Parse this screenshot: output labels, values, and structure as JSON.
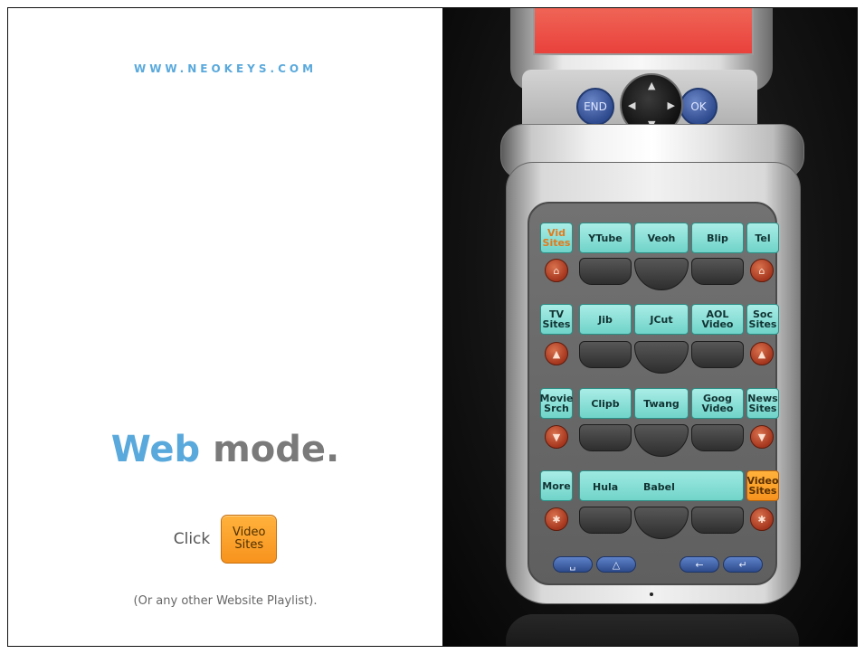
{
  "left": {
    "url": "WWW.NEOKEYS.COM",
    "title_part1": "Web",
    "title_part2": " mode.",
    "click_label": "Click",
    "button_label": "Video\nSites",
    "note": "(Or any other Website Playlist)."
  },
  "device": {
    "end_label": "END",
    "ok_label": "OK",
    "dpad": {
      "up": "▲",
      "down": "▼",
      "left": "◀",
      "right": "▶"
    },
    "rows": [
      {
        "left": "Vid\nSites",
        "mid": [
          "YTube",
          "Veoh",
          "Blip"
        ],
        "right": "Tel",
        "icon": "⌂"
      },
      {
        "left": "TV\nSites",
        "mid": [
          "Jib",
          "JCut",
          "AOL\nVideo"
        ],
        "right": "Soc\nSites",
        "icon": "▲"
      },
      {
        "left": "Movie\nSrch",
        "mid": [
          "Clipb",
          "Twang",
          "Goog\nVideo"
        ],
        "right": "News\nSites",
        "icon": "▼"
      },
      {
        "left": "More",
        "mid": [
          "Hula",
          "Babel"
        ],
        "right": "Video\nSites",
        "icon": "✱"
      }
    ],
    "bottom_keys": [
      "␣",
      "△",
      "←",
      "↵"
    ]
  },
  "colors": {
    "accent_blue": "#5aa9dc",
    "title_gray": "#7a7a7a",
    "key_teal": "#7ddbd1",
    "key_orange": "#f7931e",
    "round_red": "#b8482b",
    "screen_red": "#ec5147"
  }
}
